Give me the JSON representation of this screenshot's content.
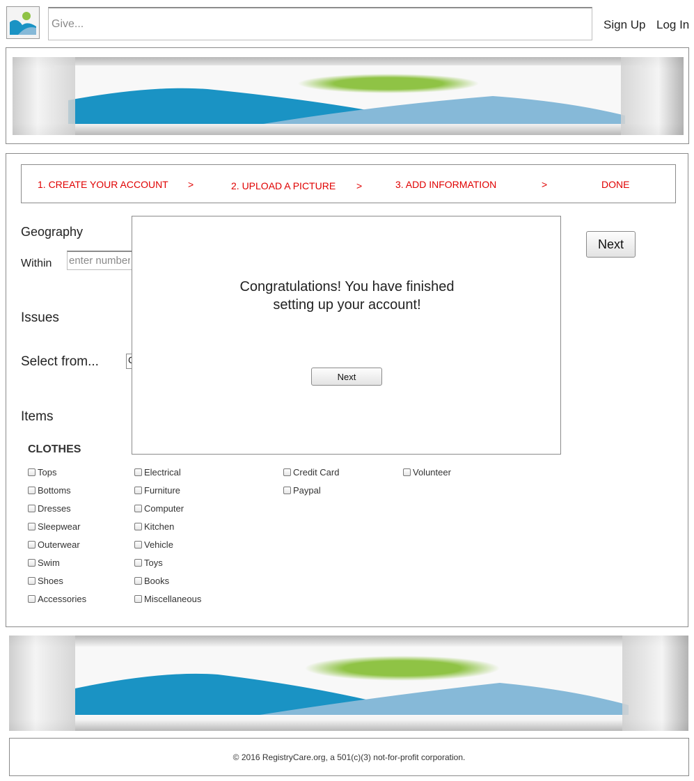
{
  "header": {
    "logo_icon": "image-placeholder-icon",
    "search_placeholder": "Give...",
    "signup_label": "Sign Up",
    "login_label": "Log In"
  },
  "banners": {
    "image_icon": "landscape-banner-image"
  },
  "steps": [
    {
      "label": "1. CREATE YOUR ACCOUNT"
    },
    {
      "label": ">"
    },
    {
      "label": "2. UPLOAD A PICTURE"
    },
    {
      "label": ">"
    },
    {
      "label": "3. ADD INFORMATION"
    },
    {
      "label": ">"
    },
    {
      "label": "DONE"
    }
  ],
  "form": {
    "geography_title": "Geography",
    "within_label": "Within",
    "within_placeholder": "enter number",
    "issues_title": "Issues",
    "select_from_label": "Select from...",
    "select_value": "C",
    "items_title": "Items",
    "next_label": "Next"
  },
  "items": {
    "category_title": "CLOTHES",
    "columns": [
      [
        "Tops",
        "Bottoms",
        "Dresses",
        "Sleepwear",
        "Outerwear",
        "Swim",
        "Shoes",
        "Accessories"
      ],
      [
        "Electrical",
        "Furniture",
        "Computer",
        "Kitchen",
        "Vehicle",
        "Toys",
        "Books",
        "Miscellaneous"
      ],
      [
        "Credit Card",
        "Paypal"
      ],
      [
        "Volunteer"
      ]
    ]
  },
  "modal": {
    "message_line1": "Congratulations! You have finished",
    "message_line2": "setting up your account!",
    "next_label": "Next"
  },
  "footer": {
    "copyright": "© 2016 RegistryCare.org, a 501(c)(3) not-for-profit corporation."
  },
  "colors": {
    "step_text": "#e00000",
    "banner_blue": "#1a93c4",
    "banner_light_blue": "#86b9d8",
    "banner_green": "#8fc345"
  }
}
